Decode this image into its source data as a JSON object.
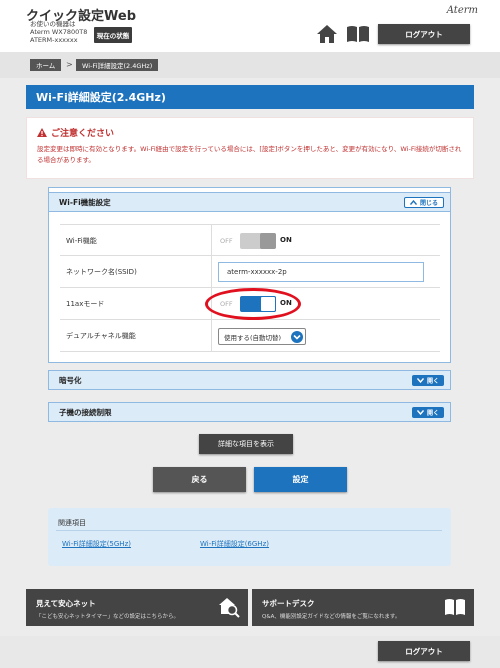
{
  "header": {
    "app_title": "クイック設定Web",
    "device_line1": "お使いの機器は",
    "device_line2": "Aterm WX7800T8",
    "device_line3": "ATERM-xxxxxx",
    "status_button": "現在の状態",
    "brand": "Aterm",
    "logout": "ログアウト"
  },
  "breadcrumb": {
    "home": "ホーム",
    "separator": ">",
    "current": "Wi-Fi詳細設定(2.4GHz)"
  },
  "page_title": "Wi-Fi詳細設定(2.4GHz)",
  "notice": {
    "title": "ご注意ください",
    "text": "設定変更は即時に有効となります。Wi-Fi経由で設定を行っている場合には、[設定]ボタンを押したあと、変更が有効になり、Wi-Fi接続が切断される場合があります。"
  },
  "wifi_section": {
    "title": "Wi-Fi機能設定",
    "toggle": "閉じる",
    "rows": [
      {
        "label": "Wi-Fi機能",
        "off": "OFF",
        "on": "ON"
      },
      {
        "label": "ネットワーク名(SSID)",
        "value": "aterm-xxxxxx-2p"
      },
      {
        "label": "11axモード",
        "off": "OFF",
        "on": "ON"
      },
      {
        "label": "デュアルチャネル機能",
        "value": "使用する(自動切替)"
      }
    ]
  },
  "wifi_switch_state": "on",
  "ax_switch_state": "on",
  "encryption_section": {
    "title": "暗号化",
    "toggle": "開く"
  },
  "child_section": {
    "title": "子機の接続制限",
    "toggle": "開く"
  },
  "buttons": {
    "show_details": "詳細な項目を表示",
    "back": "戻る",
    "apply": "設定"
  },
  "related": {
    "title": "関連項目",
    "links": [
      "Wi-Fi詳細設定(5GHz)",
      "Wi-Fi詳細設定(6GHz)"
    ]
  },
  "footer": {
    "card1_title": "見えて安心ネット",
    "card1_sub": "「こども安心ネットタイマー」などの設定はこちらから。",
    "card2_title": "サポートデスク",
    "card2_sub": "Q&A、機能別設定ガイドなどの情報をご覧になれます。"
  },
  "colors": {
    "primary": "#1e73be",
    "dark": "#444444",
    "warning": "#c03030",
    "highlight": "#e0101f"
  },
  "icons": [
    "home-icon",
    "book-icon",
    "warning-icon",
    "chevron-up-icon",
    "chevron-down-icon",
    "search-house-icon"
  ]
}
